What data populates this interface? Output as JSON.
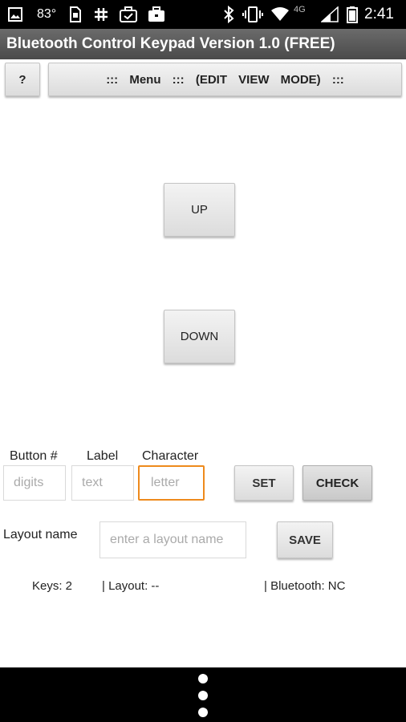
{
  "status_bar": {
    "temperature": "83°",
    "network": "4G",
    "time": "2:41",
    "icons": [
      "image-icon",
      "temperature-icon",
      "sim-card-icon",
      "hashtag-icon",
      "briefcase-check-icon",
      "briefcase-icon",
      "bluetooth-icon",
      "vibrate-icon",
      "wifi-icon",
      "signal-icon",
      "battery-icon"
    ]
  },
  "app": {
    "title": "Bluetooth Control Keypad Version 1.0 (FREE)"
  },
  "toolbar": {
    "help_label": "?",
    "menu_label": "::: Menu ::: (EDIT VIEW MODE) :::"
  },
  "keypad": {
    "buttons": [
      {
        "label": "UP"
      },
      {
        "label": "DOWN"
      }
    ]
  },
  "editor": {
    "button_number_label": "Button #",
    "label_label": "Label",
    "character_label": "Character",
    "button_number_placeholder": "digits",
    "label_placeholder": "text",
    "character_placeholder": "letter",
    "set_label": "SET",
    "check_label": "CHECK",
    "layout_name_label": "Layout name",
    "layout_name_placeholder": "enter a layout name",
    "save_label": "SAVE"
  },
  "status": {
    "keys": "Keys: 2",
    "layout": "| Layout: --",
    "bluetooth": "| Bluetooth: NC"
  },
  "colors": {
    "focus_border": "#ee8a1c",
    "title_bar": "#555555"
  }
}
